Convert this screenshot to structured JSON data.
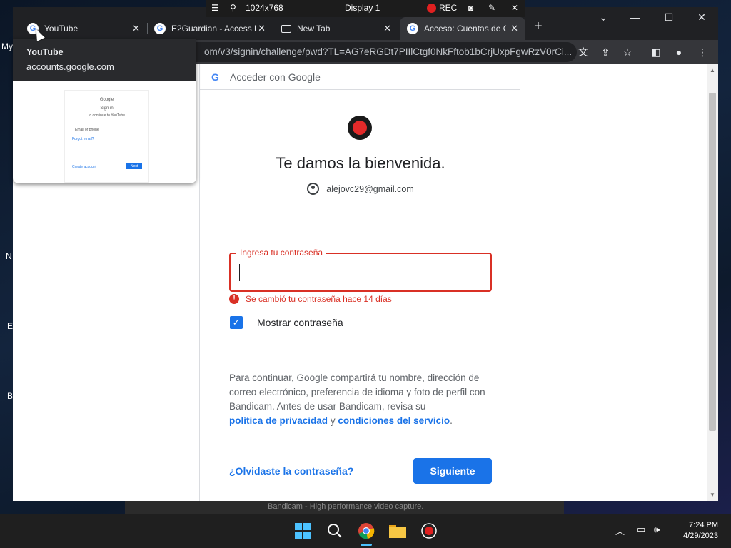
{
  "recorder": {
    "resolution": "1024x768",
    "display": "Display 1",
    "rec_label": "REC"
  },
  "desktop": {
    "edge_letters": [
      "My",
      "N",
      "E",
      "B"
    ]
  },
  "tabs": [
    {
      "title": "YouTube",
      "close": "✕"
    },
    {
      "title": "E2Guardian - Access D",
      "close": "✕"
    },
    {
      "title": "New Tab",
      "close": "✕"
    },
    {
      "title": "Acceso: Cuentas de G",
      "close": "✕"
    }
  ],
  "new_tab": "+",
  "window_controls": {
    "dropdown": "⌄",
    "minimize": "—",
    "maximize": "☐",
    "close": "✕"
  },
  "address_bar": {
    "url": "om/v3/signin/challenge/pwd?TL=AG7eRGDt7PIIlCtgf0NkFftob1bCrjUxpFgwRzV0rCi..."
  },
  "hover_card": {
    "title": "YouTube",
    "domain": "accounts.google.com",
    "thumb": {
      "brand": "Google",
      "heading": "Sign in",
      "sub": "to continue to YouTube",
      "field": "Email or phone",
      "forgot": "Forgot email?",
      "create": "Create account",
      "next": "Next"
    }
  },
  "signin": {
    "header": "Acceder con Google",
    "google_letter": "G",
    "welcome": "Te damos la bienvenida.",
    "email": "alejovc29@gmail.com",
    "password_label": "Ingresa tu contraseña",
    "password_value": "",
    "error": "Se cambió tu contraseña hace 14 días",
    "show_password": "Mostrar contraseña",
    "notice_text": "Para continuar, Google compartirá tu nombre, dirección de correo electrónico, preferencia de idioma y foto de perfil con Bandicam. Antes de usar Bandicam, revisa su",
    "privacy_link": "política de privacidad",
    "and": "y",
    "terms_link": "condiciones del servicio",
    "period": ".",
    "forgot": "¿Olvidaste la contraseña?",
    "next": "Siguiente"
  },
  "background_window": {
    "title": "Bandicam - High performance video capture."
  },
  "taskbar": {
    "time": "7:24 PM",
    "date": "4/29/2023"
  },
  "colors": {
    "accent": "#1a73e8",
    "error": "#d93025",
    "tab_bg": "#202124",
    "toolbar_bg": "#35363a"
  }
}
